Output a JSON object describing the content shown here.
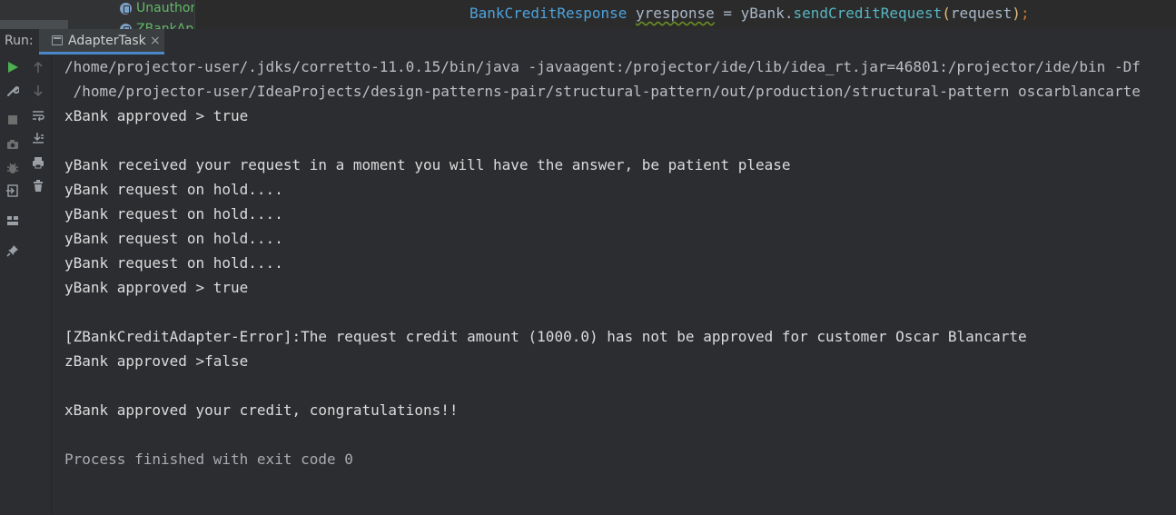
{
  "project_tree": {
    "items": [
      {
        "label": "Unauthor"
      },
      {
        "label": "ZBankApi"
      }
    ]
  },
  "editor": {
    "code_tokens": {
      "type": "BankCreditResponse",
      "var": "yresponse",
      "op": "=",
      "obj": "yBank.",
      "method": "sendCreditRequest",
      "paren_open": "(",
      "arg": "request",
      "paren_close": ")",
      "semi": ";"
    }
  },
  "run_panel": {
    "label": "Run:",
    "tab": {
      "label": "AdapterTask",
      "close": "×"
    }
  },
  "toolbar": {
    "primary": [
      {
        "icon": "rerun-icon",
        "color": "#4caf50"
      },
      {
        "icon": "wrench-icon",
        "color": "#9aa0a6"
      },
      {
        "icon": "stop-icon",
        "color": "#6e6e6e"
      },
      {
        "icon": "camera-icon",
        "color": "#6e6e6e"
      },
      {
        "icon": "debug-bug-icon",
        "color": "#6e6e6e"
      },
      {
        "icon": "exit-icon",
        "color": "#9aa0a6"
      },
      {
        "icon": "layout-icon",
        "color": "#9aa0a6"
      },
      {
        "icon": "pin-icon",
        "color": "#9aa0a6"
      }
    ],
    "secondary": [
      {
        "icon": "up-arrow-icon"
      },
      {
        "icon": "down-arrow-icon"
      },
      {
        "icon": "soft-wrap-icon"
      },
      {
        "icon": "scroll-to-end-icon"
      },
      {
        "icon": "print-icon"
      },
      {
        "icon": "trash-icon"
      }
    ]
  },
  "console": {
    "lines": [
      {
        "text": "/home/projector-user/.jdks/corretto-11.0.15/bin/java -javaagent:/projector/ide/lib/idea_rt.jar=46801:/projector/ide/bin -Df",
        "kind": "cmd"
      },
      {
        "text": " /home/projector-user/IdeaProjects/design-patterns-pair/structural-pattern/out/production/structural-pattern oscarblancarte",
        "kind": "cmd"
      },
      {
        "text": "xBank approved > true",
        "kind": "out"
      },
      {
        "text": "",
        "kind": "out"
      },
      {
        "text": "yBank received your request in a moment you will have the answer, be patient please",
        "kind": "out"
      },
      {
        "text": "yBank request on hold....",
        "kind": "out"
      },
      {
        "text": "yBank request on hold....",
        "kind": "out"
      },
      {
        "text": "yBank request on hold....",
        "kind": "out"
      },
      {
        "text": "yBank request on hold....",
        "kind": "out"
      },
      {
        "text": "yBank approved > true",
        "kind": "out"
      },
      {
        "text": "",
        "kind": "out"
      },
      {
        "text": "[ZBankCreditAdapter-Error]:The request credit amount (1000.0) has not be approved for customer Oscar Blancarte",
        "kind": "out"
      },
      {
        "text": "zBank approved >false",
        "kind": "out"
      },
      {
        "text": "",
        "kind": "out"
      },
      {
        "text": "xBank approved your credit, congratulations!!",
        "kind": "out"
      },
      {
        "text": "",
        "kind": "out"
      },
      {
        "text": "Process finished with exit code 0",
        "kind": "process"
      }
    ]
  }
}
